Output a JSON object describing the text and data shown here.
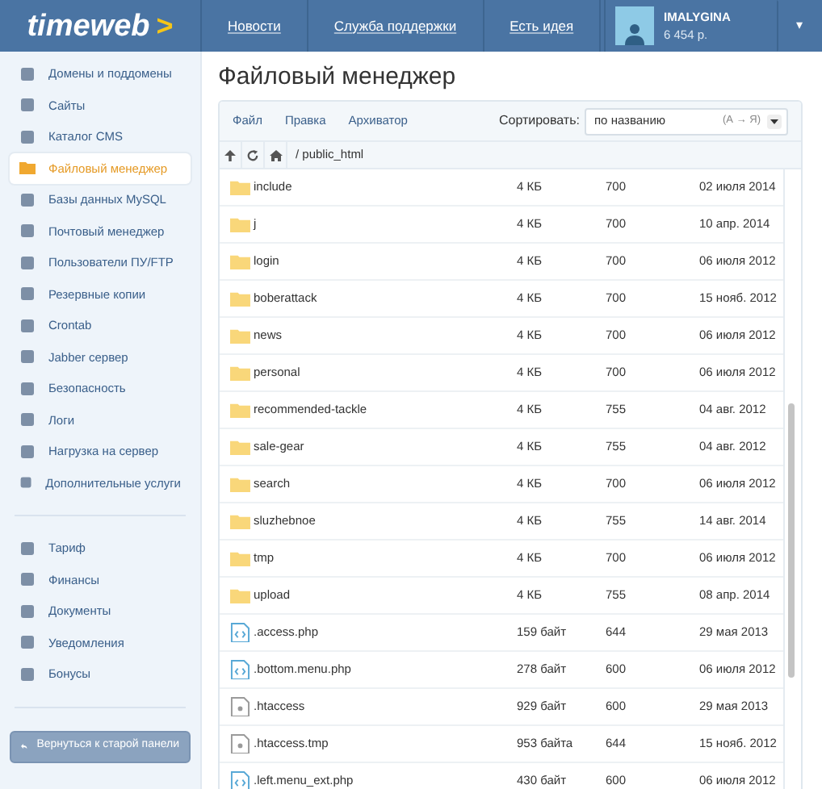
{
  "header": {
    "logo_text": "timeweb",
    "logo_mark": ">",
    "nav": [
      "Новости",
      "Служба поддержки",
      "Есть идея"
    ],
    "user": {
      "name": "IMALYGINA",
      "balance": "6 454 р.",
      "menu_caret": "▾"
    }
  },
  "sidebar": {
    "groups": [
      {
        "items": [
          {
            "label": "Домены и поддомены",
            "selected": false
          },
          {
            "label": "Сайты",
            "selected": false
          },
          {
            "label": "Каталог CMS",
            "selected": false
          },
          {
            "label": "Файловый менеджер",
            "selected": true
          },
          {
            "label": "Базы данных MySQL",
            "selected": false
          },
          {
            "label": "Почтовый менеджер",
            "selected": false
          },
          {
            "label": "Пользователи ПУ/FTP",
            "selected": false
          },
          {
            "label": "Резервные копии",
            "selected": false
          },
          {
            "label": "Crontab",
            "selected": false
          },
          {
            "label": "Jabber сервер",
            "selected": false
          },
          {
            "label": "Безопасность",
            "selected": false
          },
          {
            "label": "Логи",
            "selected": false
          },
          {
            "label": "Нагрузка на сервер",
            "selected": false
          },
          {
            "label": "Дополнительные услуги",
            "selected": false
          }
        ]
      },
      {
        "items": [
          {
            "label": "Тариф",
            "selected": false
          },
          {
            "label": "Финансы",
            "selected": false
          },
          {
            "label": "Документы",
            "selected": false
          },
          {
            "label": "Уведомления",
            "selected": false
          },
          {
            "label": "Бонусы",
            "selected": false
          }
        ]
      }
    ],
    "back_button": "Вернуться к старой панели"
  },
  "page_title": "Файловый менеджер",
  "toolbar": {
    "menu": [
      "Файл",
      "Правка",
      "Архиватор"
    ],
    "sort_label": "Сортировать:",
    "sort_value": "по названию",
    "sort_hint": "(А → Я)"
  },
  "path": "/ public_html",
  "files": [
    {
      "kind": "folder",
      "name": "include",
      "size": "4 КБ",
      "permissions": "700",
      "date": "02 июля 2014"
    },
    {
      "kind": "folder",
      "name": "j",
      "size": "4 КБ",
      "permissions": "700",
      "date": "10 апр. 2014"
    },
    {
      "kind": "folder",
      "name": "login",
      "size": "4 КБ",
      "permissions": "700",
      "date": "06 июля 2012"
    },
    {
      "kind": "folder",
      "name": "boberattack",
      "size": "4 КБ",
      "permissions": "700",
      "date": "15 нояб. 2012"
    },
    {
      "kind": "folder",
      "name": "news",
      "size": "4 КБ",
      "permissions": "700",
      "date": "06 июля 2012"
    },
    {
      "kind": "folder",
      "name": "personal",
      "size": "4 КБ",
      "permissions": "700",
      "date": "06 июля 2012"
    },
    {
      "kind": "folder",
      "name": "recommended-tackle",
      "size": "4 КБ",
      "permissions": "755",
      "date": "04 авг. 2012"
    },
    {
      "kind": "folder",
      "name": "sale-gear",
      "size": "4 КБ",
      "permissions": "755",
      "date": "04 авг. 2012"
    },
    {
      "kind": "folder",
      "name": "search",
      "size": "4 КБ",
      "permissions": "700",
      "date": "06 июля 2012"
    },
    {
      "kind": "folder",
      "name": "sluzhebnoe",
      "size": "4 КБ",
      "permissions": "755",
      "date": "14 авг. 2014"
    },
    {
      "kind": "folder",
      "name": "tmp",
      "size": "4 КБ",
      "permissions": "700",
      "date": "06 июля 2012"
    },
    {
      "kind": "folder",
      "name": "upload",
      "size": "4 КБ",
      "permissions": "755",
      "date": "08 апр. 2014"
    },
    {
      "kind": "code",
      "name": ".access.php",
      "size": "159 байт",
      "permissions": "644",
      "date": "29 мая 2013"
    },
    {
      "kind": "code",
      "name": ".bottom.menu.php",
      "size": "278 байт",
      "permissions": "600",
      "date": "06 июля 2012"
    },
    {
      "kind": "text",
      "name": ".htaccess",
      "size": "929 байт",
      "permissions": "600",
      "date": "29 мая 2013"
    },
    {
      "kind": "text",
      "name": ".htaccess.tmp",
      "size": "953 байта",
      "permissions": "644",
      "date": "15 нояб. 2012"
    },
    {
      "kind": "code",
      "name": ".left.menu_ext.php",
      "size": "430 байт",
      "permissions": "600",
      "date": "06 июля 2012"
    }
  ]
}
